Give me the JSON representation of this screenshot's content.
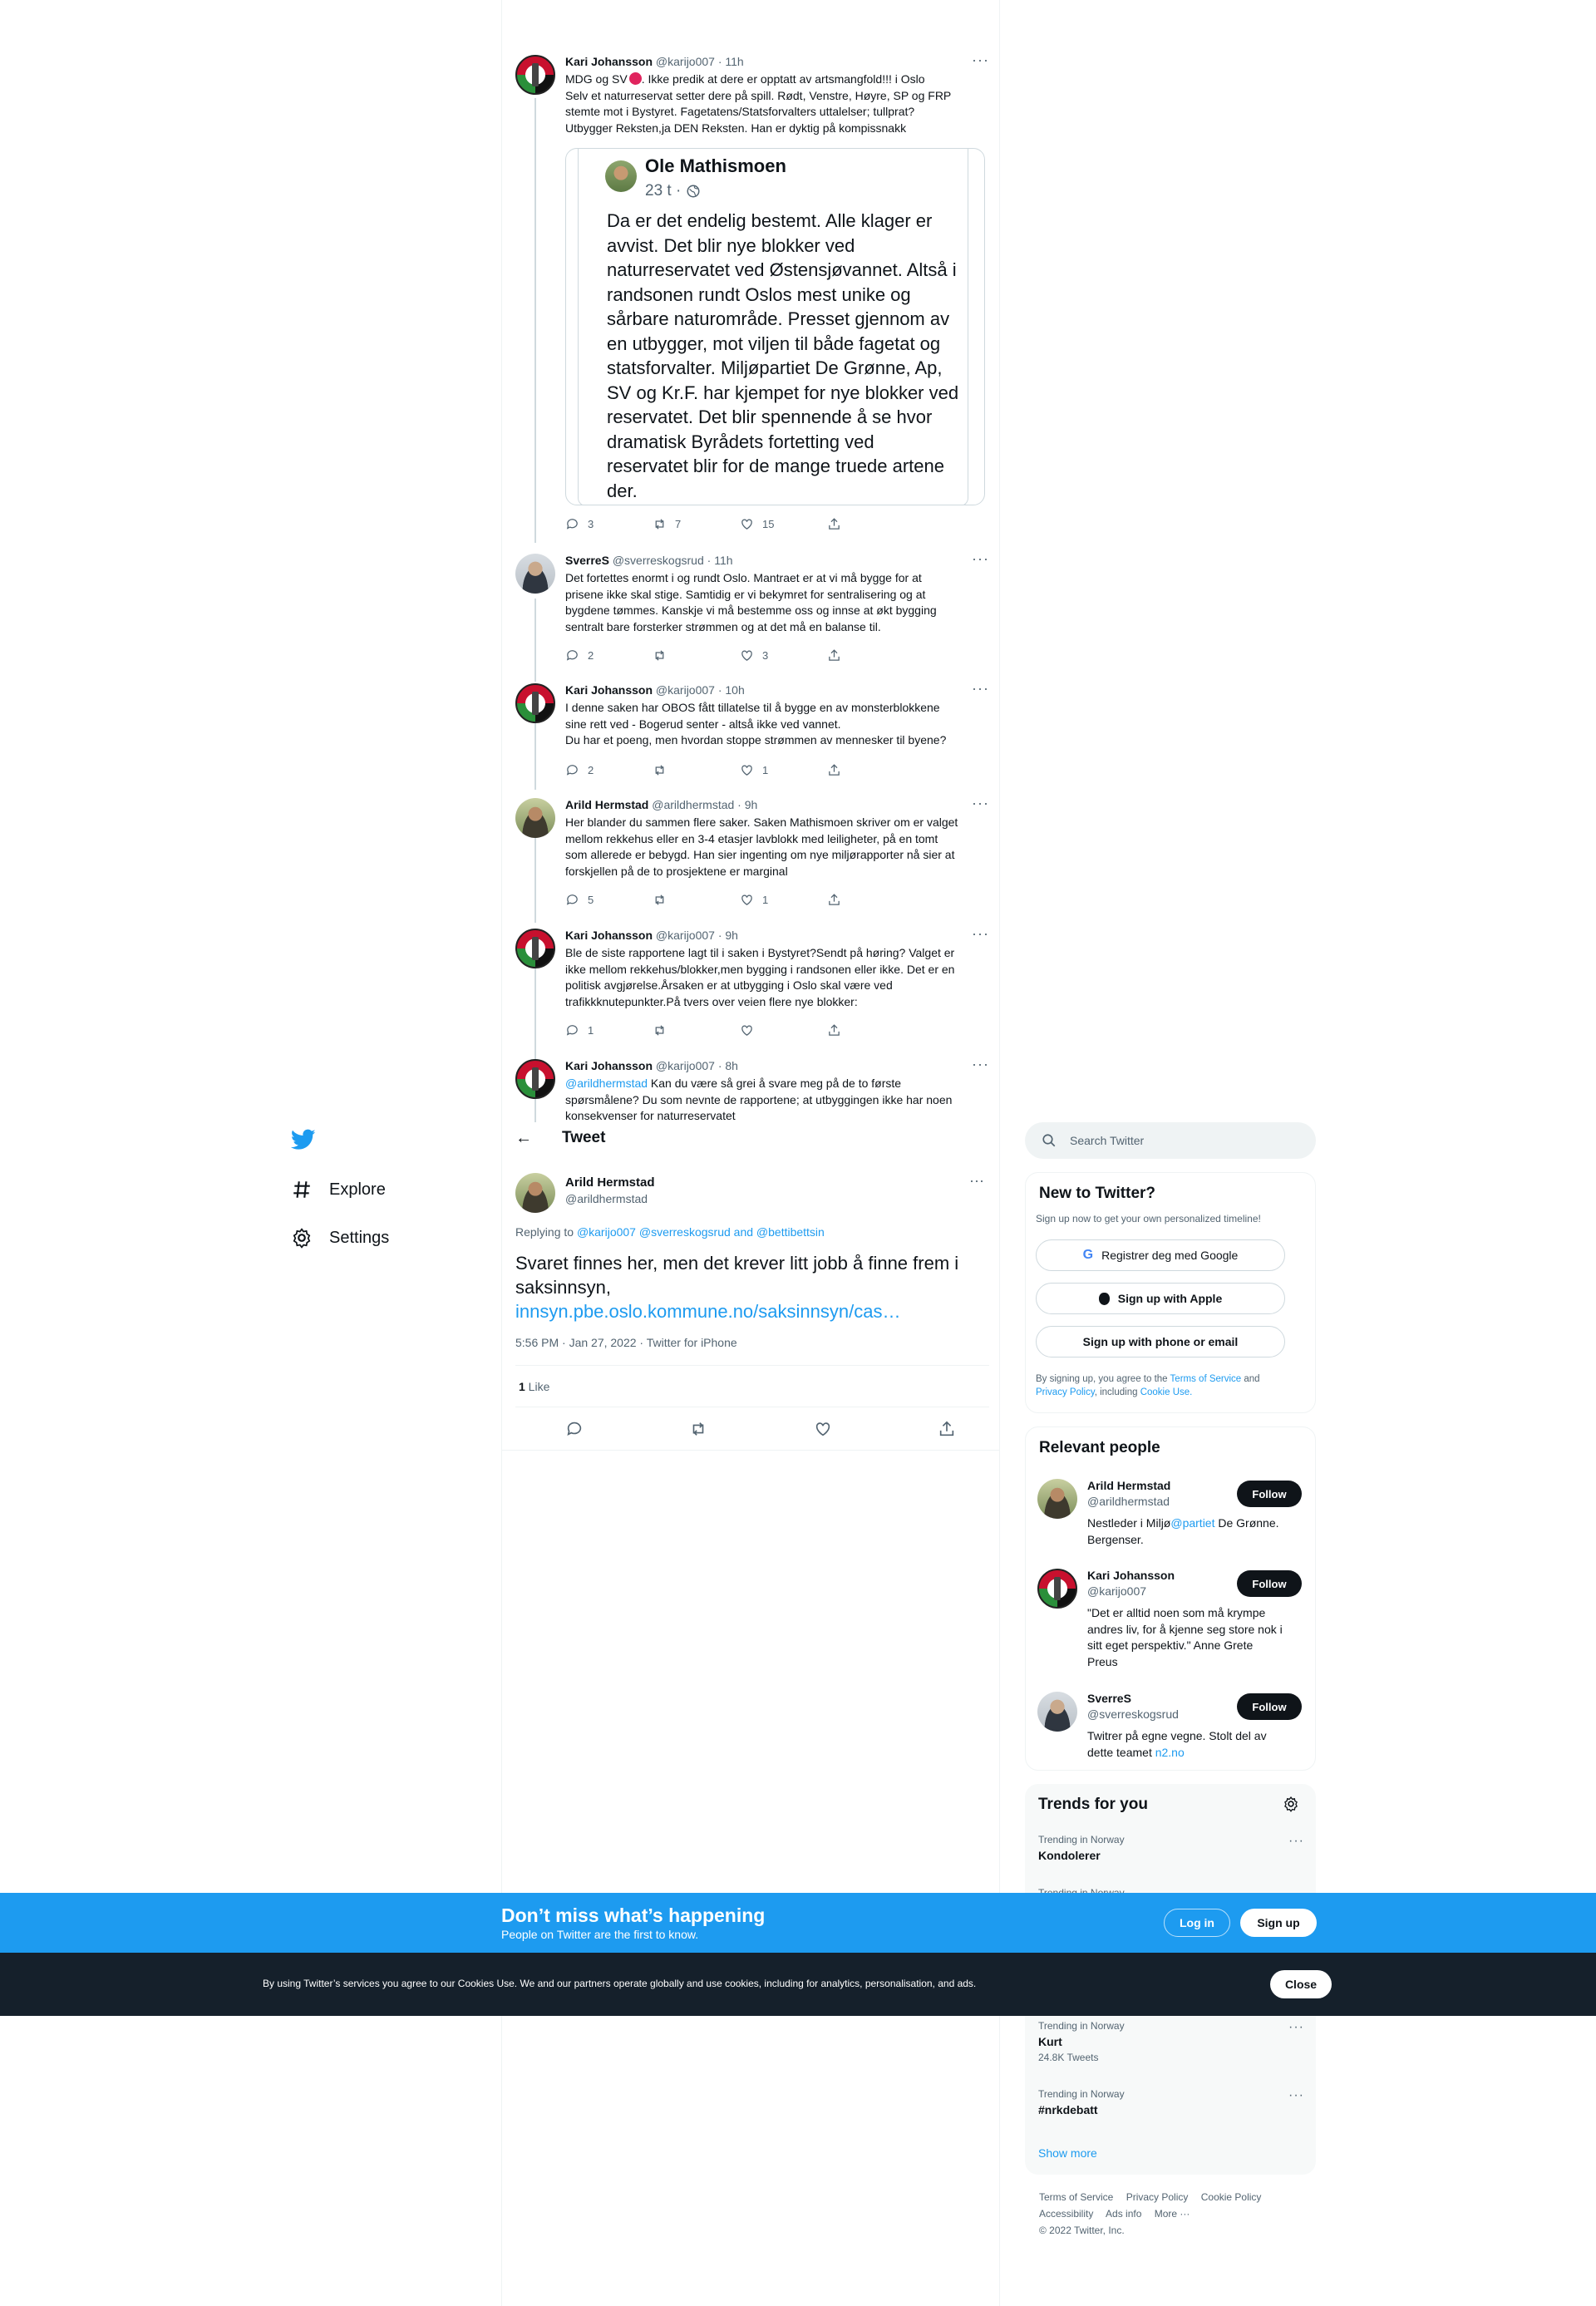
{
  "colors": {
    "accent": "#1d9bf0",
    "text": "#0f1419",
    "muted": "#536471",
    "banner": "#1d9bf0",
    "cookie_bg": "#15202b"
  },
  "nav": {
    "logo": "twitter-bird-icon",
    "explore": "Explore",
    "settings": "Settings"
  },
  "thread": [
    {
      "name": "Kari Johansson",
      "handle": "@karijo007",
      "time": "· 11h",
      "lines": [
        "MDG og SV",
        ". Ikke predik at dere er opptatt av artsmangfold!!! i Oslo",
        "Selv et naturreservat setter dere på spill. Rødt, Venstre, Høyre, SP og FRP",
        "stemte mot i Bystyret. Fagetatens/Statsforvalters uttalelser; tullprat?",
        "Utbygger Reksten,ja DEN Reksten. Han er dyktig på kompissnakk"
      ],
      "replies": "3",
      "retweets": "7",
      "likes": "15"
    },
    {
      "name": "SverreS",
      "handle": "@sverreskogsrud",
      "time": "· 11h",
      "lines": [
        "Det fortettes enormt i og rundt Oslo. Mantraet er at vi må bygge for at",
        "prisene ikke skal stige. Samtidig er vi bekymret for sentralisering og at",
        "bygdene tømmes. Kanskje vi må bestemme oss og innse at økt bygging",
        "sentralt bare forsterker strømmen og at det må en balanse til."
      ],
      "replies": "2",
      "retweets": "",
      "likes": "3"
    },
    {
      "name": "Kari Johansson",
      "handle": "@karijo007",
      "time": "· 10h",
      "lines": [
        "I denne saken har OBOS fått tillatelse til å bygge en av monsterblokkene",
        "sine rett ved - Bogerud senter - altså ikke ved vannet.",
        "Du har et poeng, men hvordan stoppe strømmen av mennesker til byene?"
      ],
      "replies": "2",
      "retweets": "",
      "likes": "1"
    },
    {
      "name": "Arild Hermstad",
      "handle": "@arildhermstad",
      "time": "· 9h",
      "lines": [
        "Her blander du sammen flere saker. Saken Mathismoen skriver om er valget",
        "mellom rekkehus eller en 3-4 etasjer lavblokk med leiligheter, på en tomt",
        "som allerede er bebygd. Han sier ingenting om nye miljørapporter nå sier at",
        "forskjellen på de to prosjektene er marginal"
      ],
      "replies": "5",
      "retweets": "",
      "likes": "1"
    },
    {
      "name": "Kari Johansson",
      "handle": "@karijo007",
      "time": "· 9h",
      "lines": [
        "Ble de siste rapportene lagt til i saken i Bystyret?Sendt på høring? Valget er",
        "ikke mellom rekkehus/blokker,men bygging i randsonen eller ikke. Det er en",
        "politisk avgjørelse.Årsaken er at utbygging i Oslo skal være ved",
        "trafikkknutepunkter.På tvers over veien flere nye blokker:"
      ],
      "replies": "1",
      "retweets": "",
      "likes": ""
    },
    {
      "name": "Kari Johansson",
      "handle": "@karijo007",
      "time": "· 8h",
      "mention": "@arildhermstad",
      "lines": [
        " Kan du være så grei å svare meg på de to første",
        "spørsmålene? Du som nevnte de rapportene; at utbyggingen ikke har noen",
        "konsekvenser for naturreservatet"
      ]
    }
  ],
  "quote": {
    "name": "Ole Mathismoen",
    "meta": "23 t ·",
    "lines": [
      "Da er det endelig bestemt. Alle klager er",
      "avvist. Det blir nye blokker ved",
      "naturreservatet ved Østensjøvannet. Altså i",
      "randsonen rundt Oslos mest unike og",
      "sårbare naturområde. Presset gjennom av",
      "en utbygger, mot viljen til både fagetat og",
      "statsforvalter. Miljøpartiet De Grønne, Ap,",
      "SV og Kr.F. har kjempet for nye blokker ved",
      "reservatet. Det blir spennende å se hvor",
      "dramatisk Byrådets fortetting ved",
      "reservatet blir for de mange truede artene",
      "der."
    ]
  },
  "main": {
    "header_title": "Tweet",
    "name": "Arild Hermstad",
    "handle": "@arildhermstad",
    "replying_label": "Replying to ",
    "replying_handles": "@karijo007 @sverreskogsrud and @bettibettsin",
    "text_line1": "Svaret finnes her, men det krever litt jobb å finne frem i",
    "text_line2": "saksinnsyn,",
    "link": "innsyn.pbe.oslo.kommune.no/saksinnsyn/cas…",
    "meta": "5:56 PM · Jan 27, 2022 · Twitter for iPhone",
    "likes_count": "1",
    "likes_label": " Like"
  },
  "right": {
    "search_placeholder": "Search Twitter",
    "new_title": "New to Twitter?",
    "new_sub": "Sign up now to get your own personalized timeline!",
    "google": "Registrer deg med Google",
    "apple": "Sign up with Apple",
    "phone": "Sign up with phone or email",
    "terms_pre": "By signing up, you agree to the ",
    "terms_tos": "Terms of Service",
    "terms_and": " and",
    "terms_privacy": "Privacy Policy",
    "terms_including": ", including ",
    "terms_cookie": "Cookie Use.",
    "relevant_title": "Relevant people",
    "people": [
      {
        "name": "Arild Hermstad",
        "handle": "@arildhermstad",
        "bio1": "Nestleder i Miljø",
        "bio_link": "@partiet",
        "bio2": " De Grønne.",
        "bio3": "Bergenser."
      },
      {
        "name": "Kari Johansson",
        "handle": "@karijo007",
        "bio_lines": [
          "\"Det er alltid noen som må krympe",
          "andres liv, for å kjenne seg store nok i",
          "sitt eget perspektiv.\" Anne Grete",
          "Preus"
        ]
      },
      {
        "name": "SverreS",
        "handle": "@sverreskogsrud",
        "bio1": "Twitrer på egne vegne. Stolt del av",
        "bio2": "dette teamet ",
        "bio_link": "n2.no"
      }
    ],
    "follow_label": "Follow",
    "trends_title": "Trends for you",
    "trends": [
      {
        "context": "Trending in Norway",
        "name": "Kondolerer",
        "count": ""
      },
      {
        "context": "Trending in Norway",
        "name": "",
        "count": ""
      },
      {
        "context": "Trending in Norway",
        "name": "Kurt",
        "count": "24.8K Tweets"
      },
      {
        "context": "Trending in Norway",
        "name": "#nrkdebatt",
        "count": ""
      }
    ],
    "show_more": "Show more",
    "footer": [
      "Terms of Service",
      "Privacy Policy",
      "Cookie Policy",
      "Accessibility",
      "Ads info",
      "More ···",
      "© 2022 Twitter, Inc."
    ]
  },
  "banner": {
    "title": "Don’t miss what’s happening",
    "subtitle": "People on Twitter are the first to know.",
    "login": "Log in",
    "signup": "Sign up"
  },
  "cookie": {
    "text": "By using Twitter’s services you agree to our Cookies Use. We and our partners operate globally and use cookies, including for analytics, personalisation, and ads.",
    "close": "Close"
  }
}
